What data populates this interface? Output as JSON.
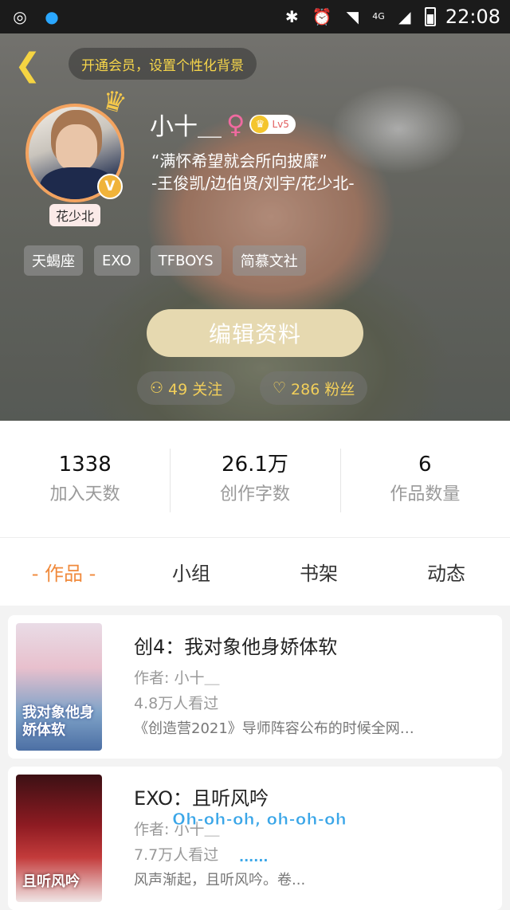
{
  "status_bar": {
    "time": "22:08",
    "network_label": "4G",
    "icons": [
      "netease-music-icon",
      "qq-icon",
      "bluetooth-icon",
      "alarm-icon",
      "wifi-icon",
      "signal-icon",
      "battery-icon"
    ]
  },
  "header": {
    "vip_tip": "开通会员，设置个性化背景",
    "avatar_caption": "花少北",
    "username": "小十＿",
    "gender_symbol": "♀",
    "level": "Lv5",
    "verify_badge": "V",
    "bio_line1": "“满怀希望就会所向披靡”",
    "bio_line2": "-王俊凯/边伯贤/刘宇/花少北-",
    "tags": [
      "天蝎座",
      "EXO",
      "TFBOYS",
      "简慕文社"
    ],
    "edit_button": "编辑资料",
    "following_label": "49 关注",
    "fans_label": "286 粉丝"
  },
  "stats": [
    {
      "value": "1338",
      "label": "加入天数"
    },
    {
      "value": "26.1万",
      "label": "创作字数"
    },
    {
      "value": "6",
      "label": "作品数量"
    }
  ],
  "tabs": [
    "- 作品 -",
    "小组",
    "书架",
    "动态"
  ],
  "works": [
    {
      "title": "创4：我对象他身娇体软",
      "author": "作者: 小十＿",
      "views": "4.8万人看过",
      "desc": "《创造营2021》导师阵容公布的时候全网…",
      "cover_text": "我对象他身娇体软"
    },
    {
      "title": "EXO：且听风吟",
      "author": "作者: 小十＿",
      "views": "7.7万人看过",
      "desc": "风声渐起，且听风吟。卷...",
      "cover_text": "且听风吟"
    }
  ],
  "overlay": {
    "lyric": "Oh-oh-oh, oh-oh-oh",
    "dots": "......"
  },
  "colors": {
    "accent": "#f08a3c",
    "vip_gold": "#f7d64a",
    "edit_button_bg": "#e6d9b0",
    "lyric_blue": "#3aa6e8"
  }
}
